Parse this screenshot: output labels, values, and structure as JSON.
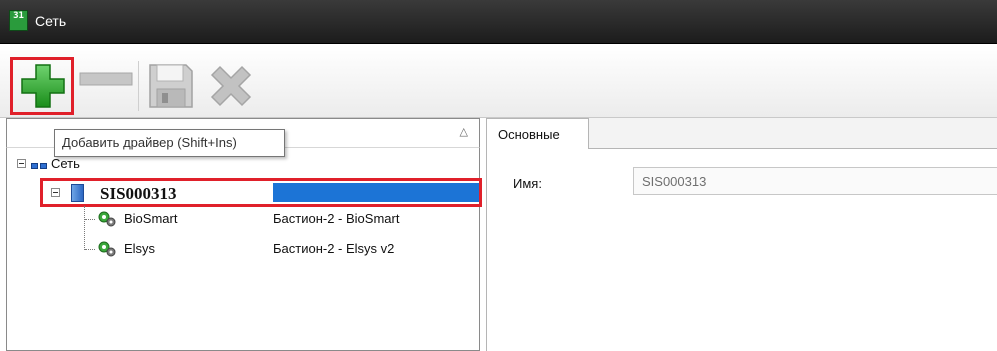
{
  "window": {
    "title": "Сеть",
    "icon_text": "31"
  },
  "toolbar": {
    "add_tooltip": "Добавить драйвер (Shift+Ins)",
    "buttons": [
      "add-icon",
      "remove-icon",
      "save-icon",
      "delete-icon"
    ]
  },
  "tree": {
    "root_label": "Сеть",
    "server_label": "SIS000313",
    "drivers": [
      {
        "name": "BioSmart",
        "type": "Бастион-2 - BioSmart"
      },
      {
        "name": "Elsys",
        "type": "Бастион-2 - Elsys v2"
      }
    ]
  },
  "properties": {
    "tab_label": "Основные",
    "name_label": "Имя:",
    "name_value": "SIS000313"
  },
  "colors": {
    "highlight_red": "#e0202a",
    "selection_blue": "#1c74d6",
    "add_green": "#2ca82c"
  }
}
